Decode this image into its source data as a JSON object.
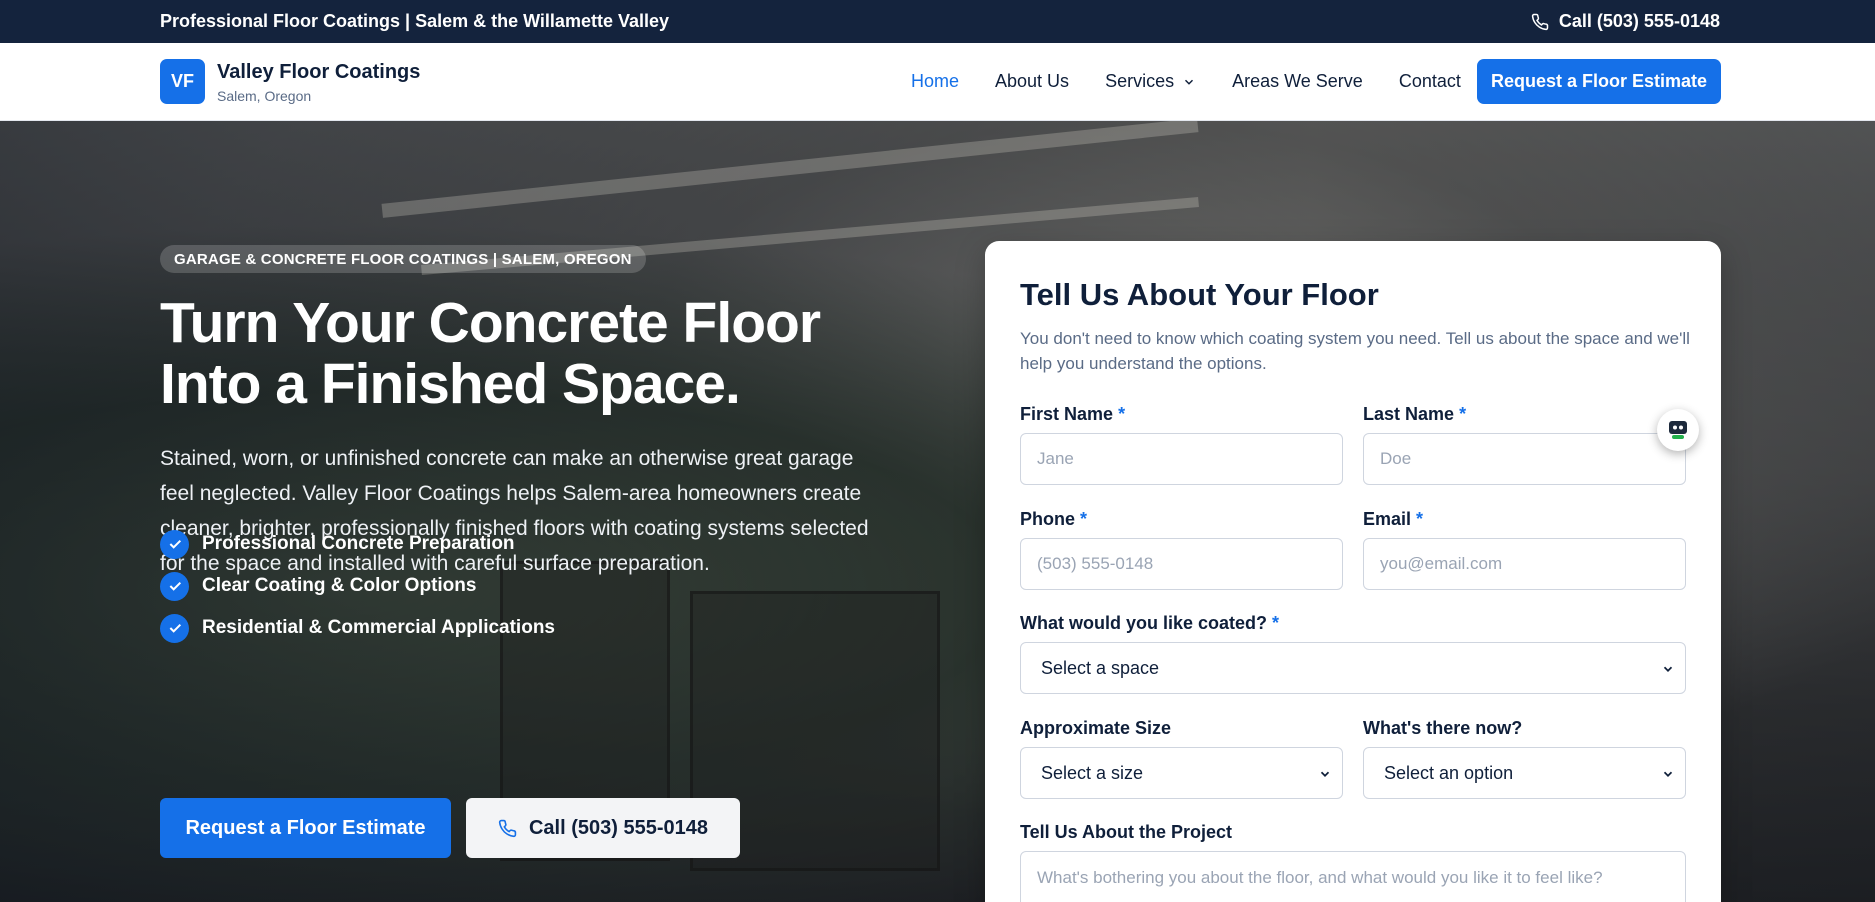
{
  "topbar": {
    "tagline": "Professional Floor Coatings | Salem & the Willamette Valley",
    "call": "Call (503) 555-0148"
  },
  "header": {
    "logo_initials": "VF",
    "brand": "Valley Floor Coatings",
    "location": "Salem, Oregon",
    "nav": [
      {
        "label": "Home",
        "active": true
      },
      {
        "label": "About Us"
      },
      {
        "label": "Services",
        "dropdown": true
      },
      {
        "label": "Areas We Serve"
      },
      {
        "label": "Contact"
      }
    ],
    "cta": "Request a Floor Estimate"
  },
  "hero": {
    "badge": "GARAGE & CONCRETE FLOOR COATINGS | SALEM, OREGON",
    "headline": "Turn Your Concrete Floor Into a Finished Space.",
    "lead": "Stained, worn, or unfinished concrete can make an otherwise great garage feel neglected. Valley Floor Coatings helps Salem-area homeowners create cleaner, brighter, professionally finished floors with coating systems selected for the space and installed with careful surface preparation.",
    "checks": [
      "Professional Concrete Preparation",
      "Clear Coating & Color Options",
      "Residential & Commercial Applications"
    ],
    "primary_button": "Request a Floor Estimate",
    "secondary_button": "Call (503) 555-0148"
  },
  "form": {
    "title": "Tell Us About Your Floor",
    "intro": "You don't need to know which coating system you need. Tell us about the space and we'll help you understand the options.",
    "required_mark": "*",
    "first_name": {
      "label": "First Name",
      "placeholder": "Jane"
    },
    "last_name": {
      "label": "Last Name",
      "placeholder": "Doe"
    },
    "phone": {
      "label": "Phone",
      "placeholder": "(503) 555-0148"
    },
    "email": {
      "label": "Email",
      "placeholder": "you@email.com"
    },
    "space": {
      "label": "What would you like coated?",
      "value": "Select a space"
    },
    "size": {
      "label": "Approximate Size",
      "value": "Select a size"
    },
    "current": {
      "label": "What's there now?",
      "value": "Select an option"
    },
    "project": {
      "label": "Tell Us About the Project",
      "placeholder": "What's bothering you about the floor, and what would you like it to feel like?"
    }
  },
  "colors": {
    "accent": "#1570e8",
    "navy": "#14233d"
  },
  "icons": {
    "phone": "phone-icon",
    "check": "check-icon",
    "chevron": "chevron-down-icon",
    "chat": "chat-widget-icon"
  }
}
